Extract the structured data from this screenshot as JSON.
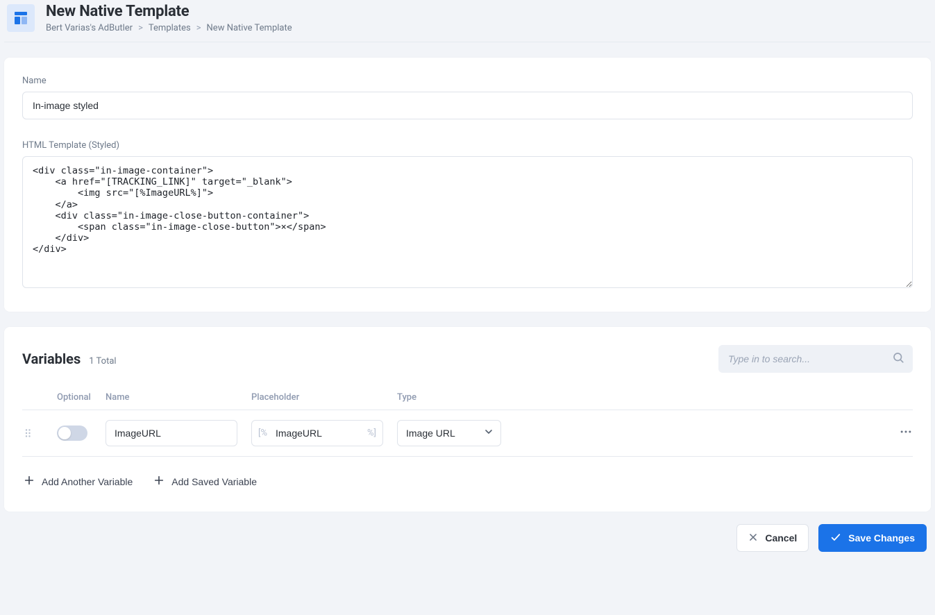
{
  "header": {
    "title": "New Native Template",
    "breadcrumb": {
      "root": "Bert Varias's AdButler",
      "section": "Templates",
      "current": "New Native Template"
    }
  },
  "form": {
    "name_label": "Name",
    "name_value": "In-image styled",
    "html_label": "HTML Template (Styled)",
    "html_value": "<div class=\"in-image-container\">\n    <a href=\"[TRACKING_LINK]\" target=\"_blank\">\n        <img src=\"[%ImageURL%]\">\n    </a>\n    <div class=\"in-image-close-button-container\">\n        <span class=\"in-image-close-button\">×</span>\n    </div>\n</div>"
  },
  "variables": {
    "title": "Variables",
    "subtitle": "1 Total",
    "search_placeholder": "Type in to search...",
    "headers": {
      "optional": "Optional",
      "name": "Name",
      "placeholder": "Placeholder",
      "type": "Type"
    },
    "rows": [
      {
        "optional": false,
        "name": "ImageURL",
        "placeholder_inner": "ImageURL",
        "placeholder_prefix": "[%",
        "placeholder_suffix": "%]",
        "type": "Image URL"
      }
    ],
    "actions": {
      "add_variable": "Add Another Variable",
      "add_saved_variable": "Add Saved Variable"
    }
  },
  "footer": {
    "cancel": "Cancel",
    "save": "Save Changes"
  }
}
